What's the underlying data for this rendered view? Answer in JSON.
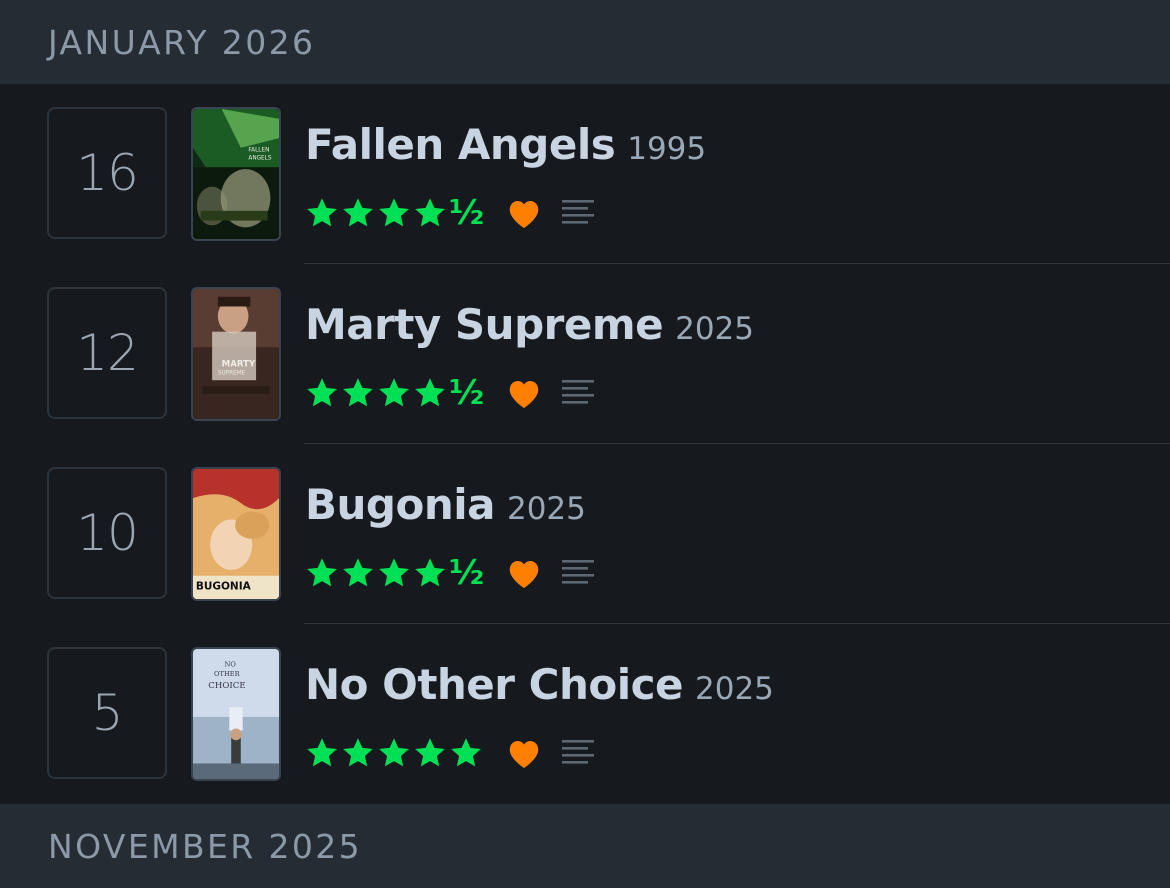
{
  "sections": [
    {
      "label": "JANUARY 2026"
    },
    {
      "label": "NOVEMBER 2025"
    }
  ],
  "colors": {
    "star": "#00e054",
    "heart": "#ff8000",
    "title": "#c8d4e2",
    "header_bg": "#262c34",
    "body_bg": "#16191d"
  },
  "entries": [
    {
      "day": "16",
      "title": "Fallen Angels",
      "year": "1995",
      "rating": 4.5,
      "rating_half_glyph": "½",
      "liked": true,
      "has_review": true,
      "poster_icon": "poster-fallen-angels"
    },
    {
      "day": "12",
      "title": "Marty Supreme",
      "year": "2025",
      "rating": 4.5,
      "rating_half_glyph": "½",
      "liked": true,
      "has_review": true,
      "poster_icon": "poster-marty-supreme"
    },
    {
      "day": "10",
      "title": "Bugonia",
      "year": "2025",
      "rating": 4.5,
      "rating_half_glyph": "½",
      "liked": true,
      "has_review": true,
      "poster_icon": "poster-bugonia"
    },
    {
      "day": "5",
      "title": "No Other Choice",
      "year": "2025",
      "rating": 5,
      "rating_half_glyph": "",
      "liked": true,
      "has_review": true,
      "poster_icon": "poster-no-other-choice"
    }
  ]
}
